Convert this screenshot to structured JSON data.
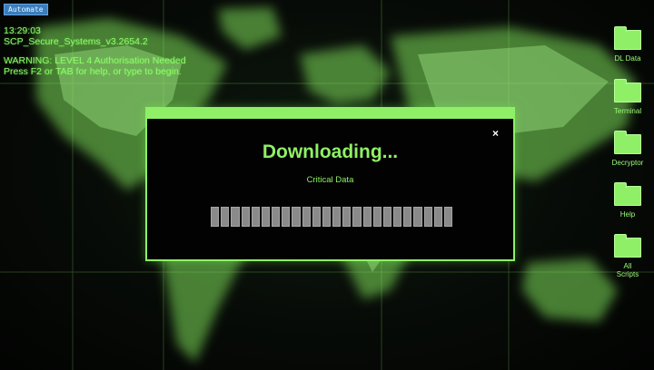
{
  "badge": {
    "label": "Automate"
  },
  "status": {
    "time": "13:29:03",
    "system": "SCP_Secure_Systems_v3.2654.2",
    "warning": "WARNING: LEVEL 4 Authorisation Needed",
    "hint": "Press F2 or TAB for help, or type to begin."
  },
  "desktop": {
    "icons": [
      {
        "label": "DL Data"
      },
      {
        "label": "Terminal"
      },
      {
        "label": "Decryptor"
      },
      {
        "label": "Help"
      },
      {
        "label": "All Scripts"
      }
    ]
  },
  "modal": {
    "close_symbol": "×",
    "heading": "Downloading...",
    "subheading": "Critical Data",
    "progress": {
      "fraction": 1.0,
      "segments": 24
    }
  },
  "colors": {
    "accent": "#8ff067",
    "background": "#050805",
    "progress_fill": "#8a8a8a",
    "badge": "#3a7dbd"
  }
}
